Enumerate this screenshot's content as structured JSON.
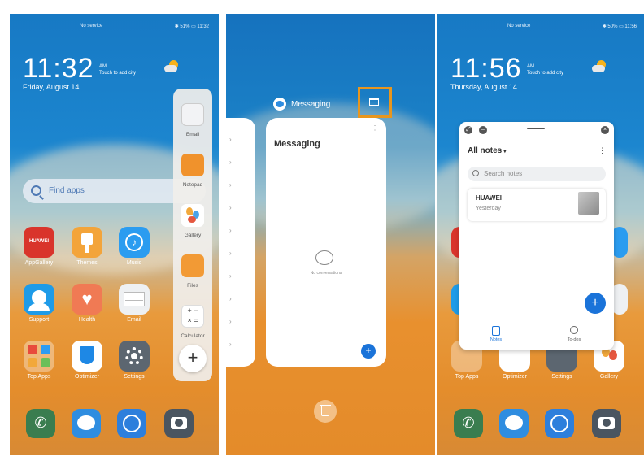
{
  "phones": [
    {
      "status_left": "No service",
      "status_right": "✱ 51% ▭ 11:32",
      "time": "11:32",
      "ampm": "AM",
      "city_hint": "Touch to add city",
      "date": "Friday, August 14",
      "search_placeholder": "Find apps",
      "apps": [
        {
          "label": "AppGallery",
          "icon": "appgallery-icon",
          "text": "HUAWEI"
        },
        {
          "label": "Themes",
          "icon": "themes-icon"
        },
        {
          "label": "Music",
          "icon": "music-icon"
        },
        {
          "label": "Support",
          "icon": "support-icon"
        },
        {
          "label": "Health",
          "icon": "health-icon"
        },
        {
          "label": "Email",
          "icon": "email-icon"
        },
        {
          "label": "Top Apps",
          "icon": "folder-icon"
        },
        {
          "label": "Optimizer",
          "icon": "optimizer-icon"
        },
        {
          "label": "Settings",
          "icon": "settings-icon"
        }
      ],
      "sidebar": [
        {
          "label": "Email",
          "icon": "email-icon"
        },
        {
          "label": "Notepad",
          "icon": "notepad-icon"
        },
        {
          "label": "Gallery",
          "icon": "gallery-icon"
        },
        {
          "label": "Files",
          "icon": "files-icon"
        },
        {
          "label": "Calculator",
          "icon": "calculator-icon"
        }
      ]
    },
    {
      "app_title": "Messaging",
      "card_title": "Messaging",
      "empty_text": "No conversations",
      "highlight_color": "#e8961e"
    },
    {
      "status_left": "No service",
      "status_right": "✱ 50% ▭ 11:56",
      "time": "11:56",
      "ampm": "AM",
      "city_hint": "Touch to add city",
      "date": "Thursday, August 14",
      "notes": {
        "header": "All notes",
        "search_placeholder": "Search notes",
        "item_title": "HUAWEI",
        "item_time": "Yesterday",
        "tab_notes": "Notes",
        "tab_todo": "To-dos"
      },
      "bottom_labels": [
        "Top Apps",
        "Optimizer",
        "Settings",
        "Gallery"
      ]
    }
  ]
}
